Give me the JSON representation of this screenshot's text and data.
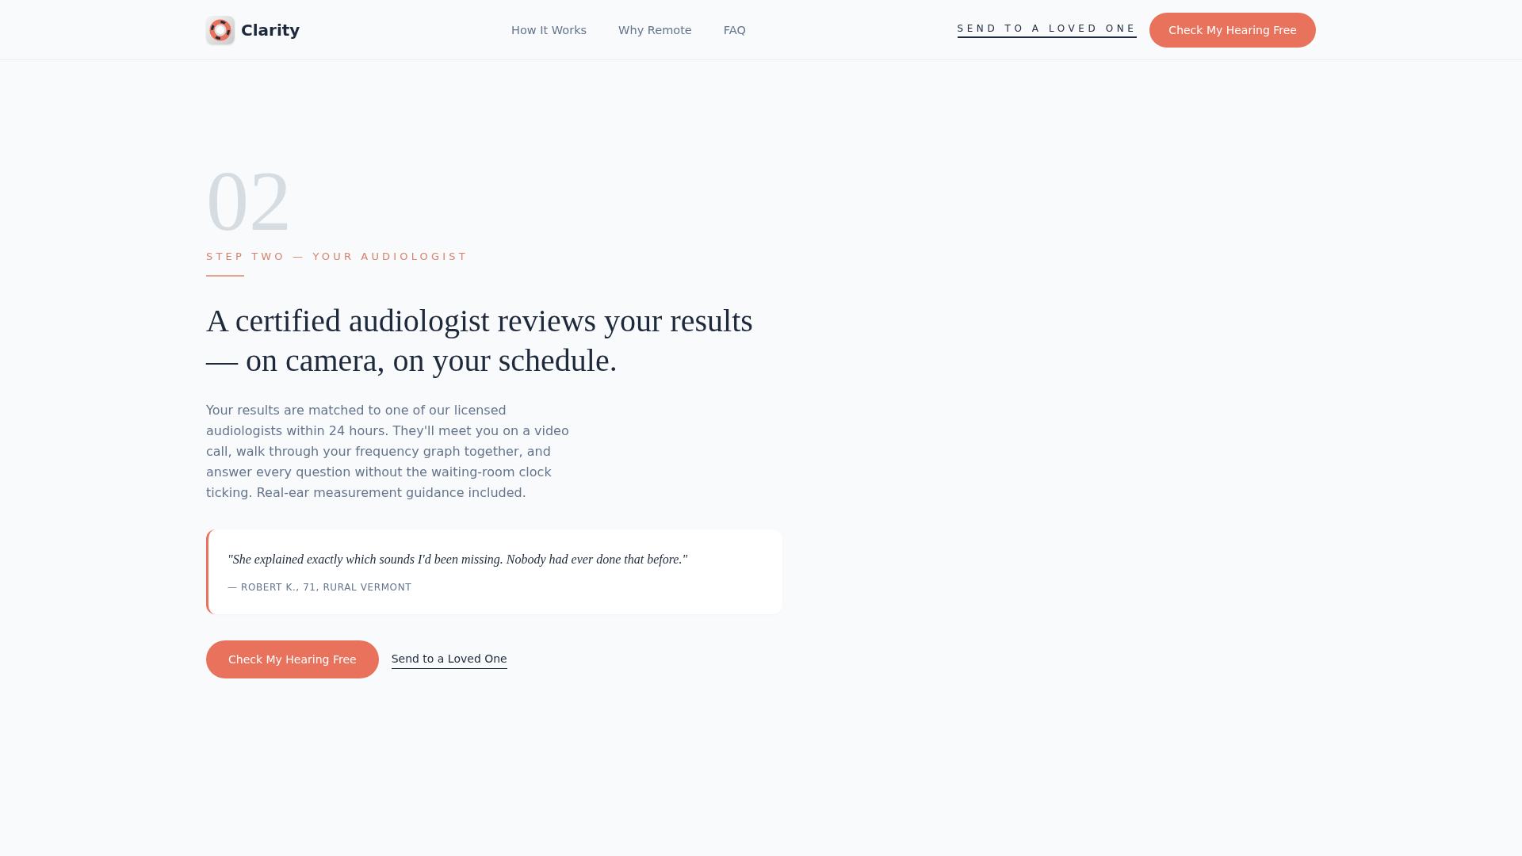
{
  "header": {
    "brand": "Clarity",
    "nav": [
      "How It Works",
      "Why Remote",
      "FAQ"
    ],
    "share_link": "SEND TO A LOVED ONE",
    "cta": "Check My Hearing Free"
  },
  "step": {
    "number": "02",
    "eyebrow": "STEP TWO — YOUR AUDIOLOGIST",
    "heading": "A certified audiologist reviews your results — on camera, on your schedule.",
    "body": "Your results are matched to one of our licensed audiologists within 24 hours. They'll meet you on a video call, walk through your frequency graph together, and answer every question without the waiting-room clock ticking. Real-ear measurement guidance included.",
    "testimonial": {
      "quote": "\"She explained exactly which sounds I'd been missing. Nobody had ever done that before.\"",
      "attribution": "— ROBERT K., 71, RURAL VERMONT"
    },
    "primary_button": "Check My Hearing Free",
    "secondary_link": "Send to a Loved One"
  }
}
